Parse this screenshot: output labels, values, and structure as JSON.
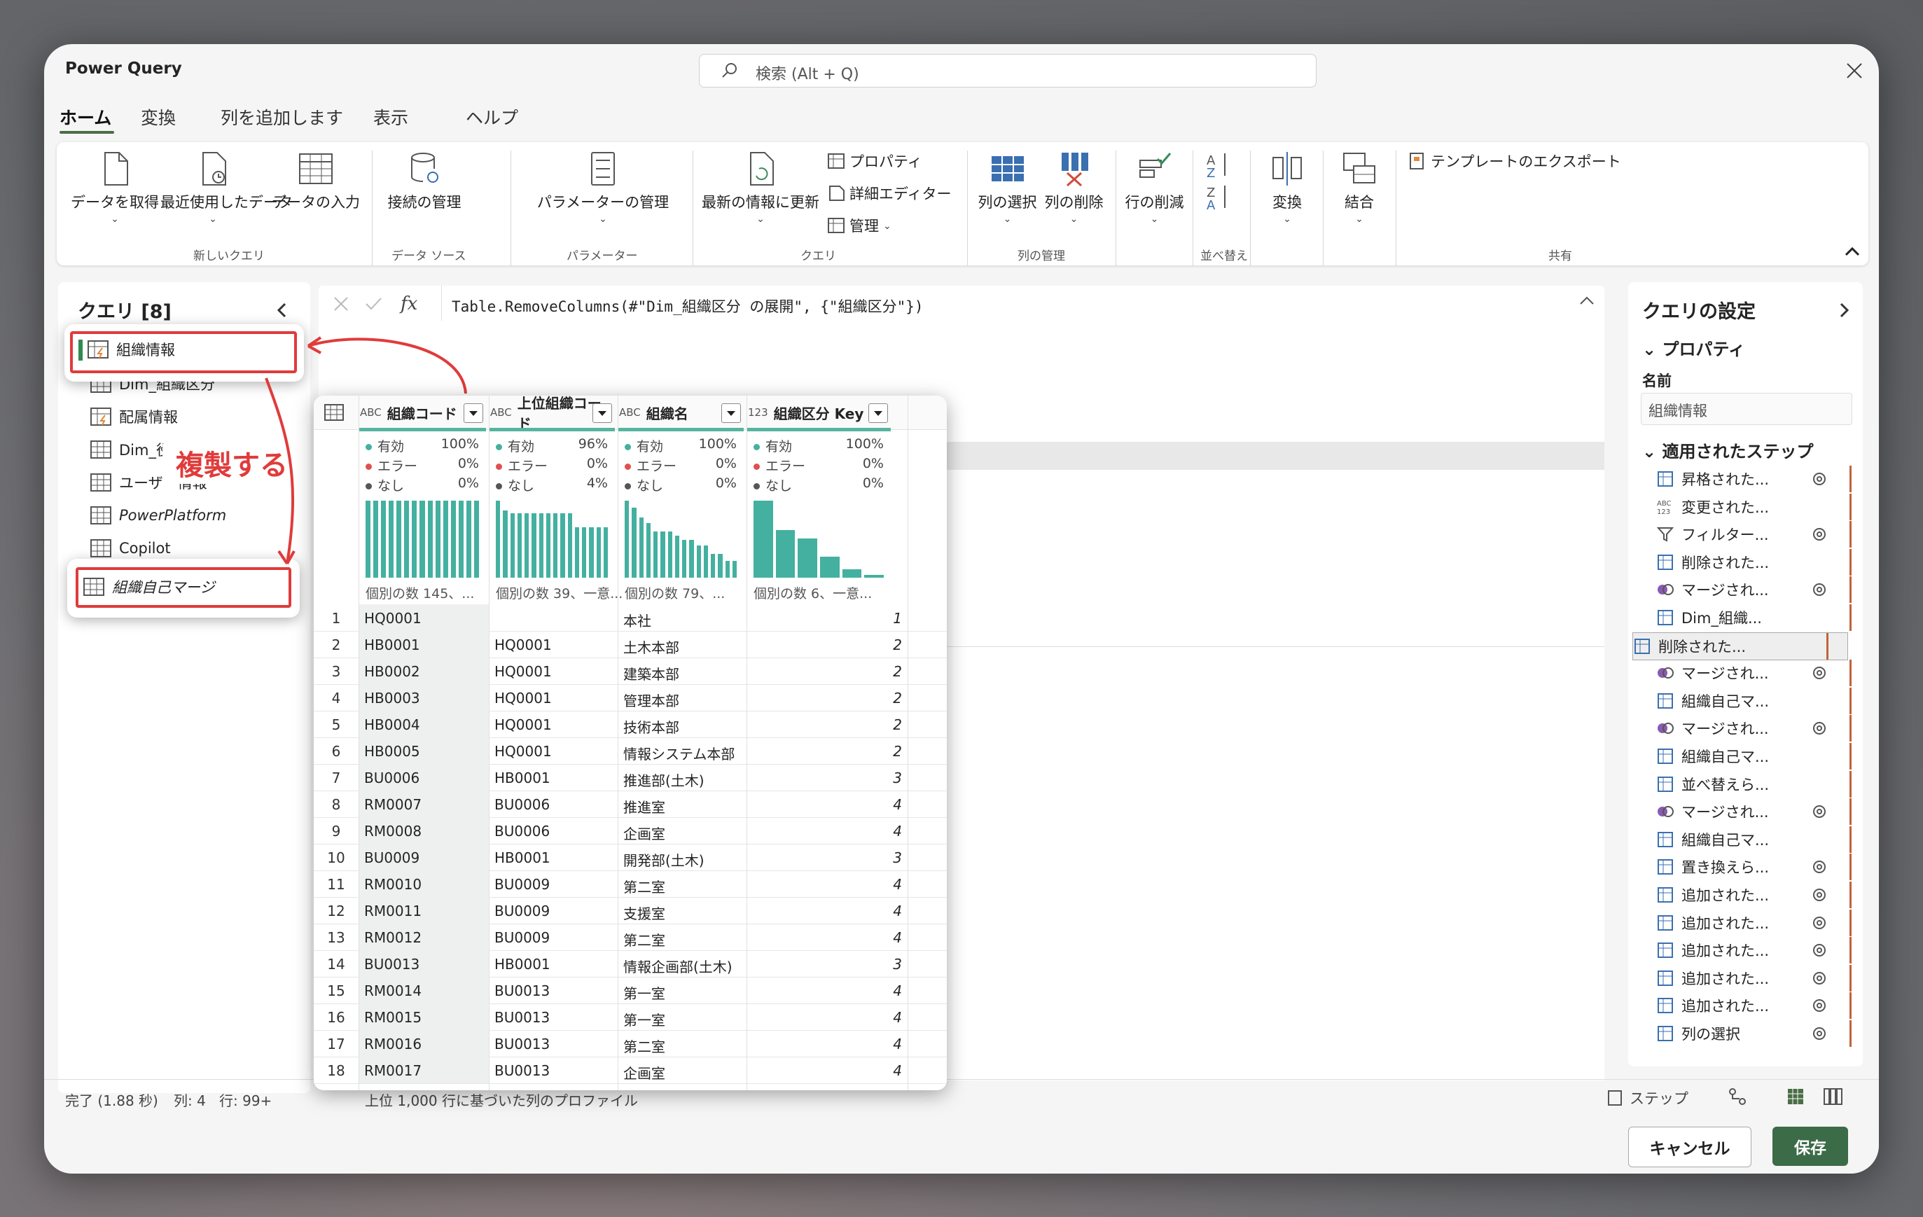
{
  "app": {
    "title": "Power Query",
    "search_placeholder": "検索 (Alt + Q)"
  },
  "tabs": [
    "ホーム",
    "変換",
    "列を追加します",
    "表示",
    "ヘルプ"
  ],
  "ribbon": {
    "get_data": "データを取得",
    "recent": "最近使用したデータ",
    "enter_data": "データの入力",
    "g_new_query": "新しいクエリ",
    "manage_conn": "接続の管理",
    "g_datasource": "データ ソース",
    "manage_params": "パラメーターの管理",
    "g_params": "パラメーター",
    "refresh": "最新の情報に更新",
    "properties": "プロパティ",
    "advanced_editor": "詳細エディター",
    "manage": "管理",
    "g_query": "クエリ",
    "choose_cols": "列の選択",
    "remove_cols": "列の削除",
    "g_manage_cols": "列の管理",
    "reduce_rows": "行の削減",
    "g_sort": "並べ替え",
    "transform": "変換",
    "combine": "結合",
    "export_template": "テンプレートのエクスポート",
    "g_share": "共有"
  },
  "queries": {
    "title": "クエリ [8]",
    "items": [
      "組織情報",
      "Dim_組織区分",
      "配属情報",
      "Dim_役",
      "ユーザー情報",
      "PowerPlatform",
      "Copilot",
      "組織自己マージ"
    ]
  },
  "annotation": {
    "label": "複製する",
    "color": "#e03b3b"
  },
  "formula": "Table.RemoveColumns(#\"Dim_組織区分 の展開\", {\"組織区分\"})",
  "columns": [
    {
      "type": "ABC",
      "name": "組織コード",
      "valid": "100%",
      "error": "0%",
      "empty": "0%",
      "distinct": "個別の数 145、..."
    },
    {
      "type": "ABC",
      "name": "上位組織コード",
      "valid": "96%",
      "error": "0%",
      "empty": "4%",
      "distinct": "個別の数 39、一意..."
    },
    {
      "type": "ABC",
      "name": "組織名",
      "valid": "100%",
      "error": "0%",
      "empty": "0%",
      "distinct": "個別の数 79、..."
    },
    {
      "type": "123",
      "name": "組織区分 Key",
      "valid": "100%",
      "error": "0%",
      "empty": "0%",
      "distinct": "個別の数 6、一意..."
    }
  ],
  "profile_labels": {
    "valid": "有効",
    "error": "エラー",
    "empty": "なし"
  },
  "rows": [
    [
      "1",
      "HQ0001",
      "",
      "本社",
      "1"
    ],
    [
      "2",
      "HB0001",
      "HQ0001",
      "土木本部",
      "2"
    ],
    [
      "3",
      "HB0002",
      "HQ0001",
      "建築本部",
      "2"
    ],
    [
      "4",
      "HB0003",
      "HQ0001",
      "管理本部",
      "2"
    ],
    [
      "5",
      "HB0004",
      "HQ0001",
      "技術本部",
      "2"
    ],
    [
      "6",
      "HB0005",
      "HQ0001",
      "情報システム本部",
      "2"
    ],
    [
      "7",
      "BU0006",
      "HB0001",
      "推進部(土木)",
      "3"
    ],
    [
      "8",
      "RM0007",
      "BU0006",
      "推進室",
      "4"
    ],
    [
      "9",
      "RM0008",
      "BU0006",
      "企画室",
      "4"
    ],
    [
      "10",
      "BU0009",
      "HB0001",
      "開発部(土木)",
      "3"
    ],
    [
      "11",
      "RM0010",
      "BU0009",
      "第二室",
      "4"
    ],
    [
      "12",
      "RM0011",
      "BU0009",
      "支援室",
      "4"
    ],
    [
      "13",
      "RM0012",
      "BU0009",
      "第二室",
      "4"
    ],
    [
      "14",
      "BU0013",
      "HB0001",
      "情報企画部(土木)",
      "3"
    ],
    [
      "15",
      "RM0014",
      "BU0013",
      "第一室",
      "4"
    ],
    [
      "16",
      "RM0015",
      "BU0013",
      "第一室",
      "4"
    ],
    [
      "17",
      "RM0016",
      "BU0013",
      "第二室",
      "4"
    ],
    [
      "18",
      "RM0017",
      "BU0013",
      "企画室",
      "4"
    ]
  ],
  "settings": {
    "title": "クエリの設定",
    "properties": "プロパティ",
    "name_label": "名前",
    "name_value": "組織情報",
    "steps_title": "適用されたステップ",
    "steps": [
      "昇格された...",
      "変更された...",
      "フィルター...",
      "削除された...",
      "マージされ...",
      "Dim_組織...",
      "削除された...",
      "マージされ...",
      "組織自己マ...",
      "マージされ...",
      "組織自己マ...",
      "並べ替えら...",
      "マージされ...",
      "組織自己マ...",
      "置き換えら...",
      "追加された...",
      "追加された...",
      "追加された...",
      "追加された...",
      "追加された...",
      "列の選択"
    ]
  },
  "status": {
    "done": "完了 (1.88 秒)",
    "cols": "列: 4",
    "rows": "行: 99+",
    "profile": "上位 1,000 行に基づいた列のプロファイル",
    "step": "ステップ"
  },
  "buttons": {
    "cancel": "キャンセル",
    "save": "保存"
  }
}
